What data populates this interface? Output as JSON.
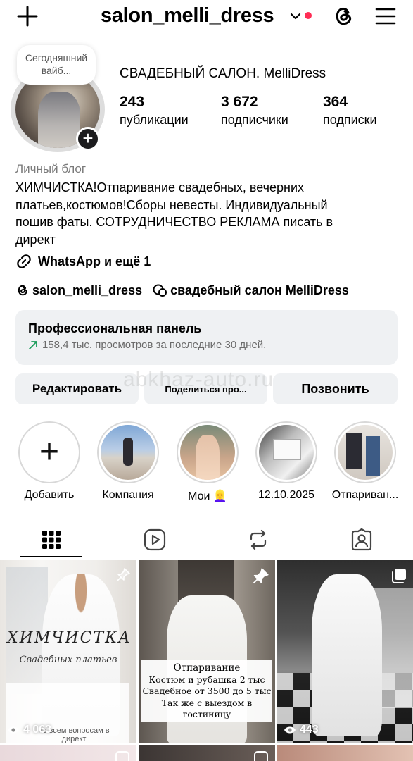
{
  "header": {
    "username": "salon_melli_dress",
    "icons": [
      "plus-icon",
      "chevron-down-icon",
      "threads-icon",
      "menu-icon"
    ],
    "notification_dot_color": "#ff2d55"
  },
  "profile": {
    "note": "Сегодняшний вайб...",
    "name": "СВАДЕБНЫЙ САЛОН. MelliDress",
    "stats": [
      {
        "value": "243",
        "label": "публикации"
      },
      {
        "value": "3 672",
        "label": "подписчики"
      },
      {
        "value": "364",
        "label": "подписки"
      }
    ],
    "category": "Личный блог",
    "bio_lines": [
      "ХИМЧИСТКА!Отпаривание свадебных, вечерних",
      "платьев,костюмов!Сборы невесты. Индивидуальный",
      "пошив фаты. СОТРУДНИЧЕСТВО РЕКЛАМА писать в",
      "директ"
    ],
    "link": "WhatsApp и ещё 1",
    "threads_handle": "salon_melli_dress",
    "channel": "свадебный салон MelliDress"
  },
  "pro_panel": {
    "title": "Профессиональная панель",
    "subtitle": "158,4 тыс. просмотров за последние 30 дней."
  },
  "buttons": {
    "edit": "Редактировать",
    "share": "Поделиться про...",
    "call": "Позвонить"
  },
  "watermark": "abkhaz-auto.ru",
  "highlights": [
    {
      "label": "Добавить"
    },
    {
      "label": "Компания"
    },
    {
      "label": "Мои 👱‍♀️"
    },
    {
      "label": "12.10.2025"
    },
    {
      "label": "Отпариван..."
    }
  ],
  "tabs": [
    "grid-icon",
    "reels-icon",
    "reposts-icon",
    "tagged-icon"
  ],
  "posts": [
    {
      "views": "4 063",
      "title": "ХИМЧИСТКА",
      "subtitle": "Свадебных платьев",
      "caption": "по всем вопросам в директ"
    },
    {
      "lines": [
        "Отпаривание",
        "Костюм и рубашка 2 тыс",
        "Свадебное от 3500 до 5 тыс",
        "Так же с выездом в",
        "гостиницу"
      ]
    },
    {
      "views": "443"
    }
  ]
}
